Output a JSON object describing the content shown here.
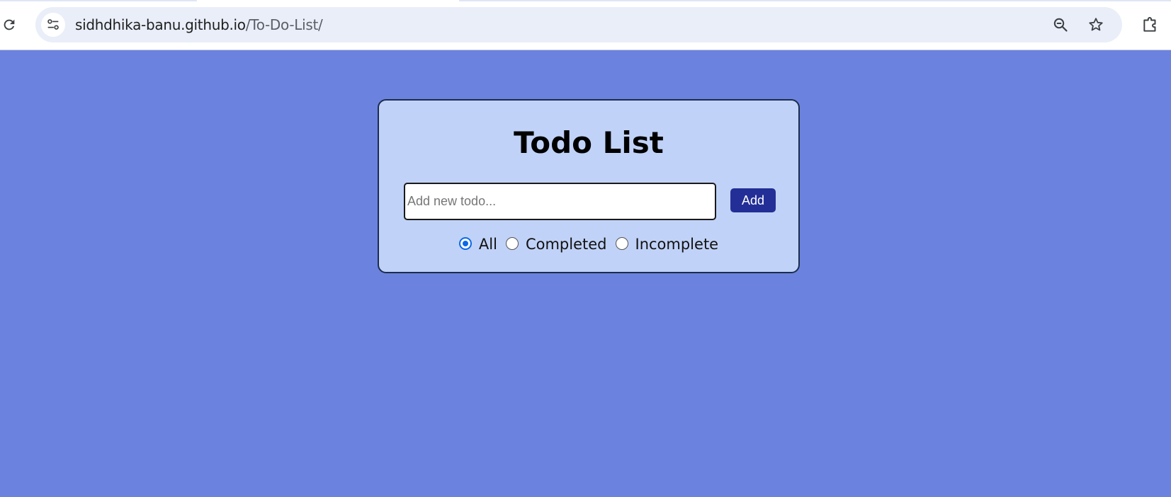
{
  "browser": {
    "url_host": "sidhdhika-banu.github.io",
    "url_path": "/To-Do-List/",
    "icons": {
      "reload": "reload-icon",
      "site_info": "tune-icon",
      "zoom": "zoom-out-icon",
      "bookmark": "star-icon",
      "extensions": "puzzle-icon"
    }
  },
  "app": {
    "title": "Todo List",
    "input": {
      "placeholder": "Add new todo...",
      "value": ""
    },
    "add_label": "Add",
    "filters": [
      {
        "label": "All",
        "checked": true
      },
      {
        "label": "Completed",
        "checked": false
      },
      {
        "label": "Incomplete",
        "checked": false
      }
    ]
  },
  "colors": {
    "page_background": "#6b82df",
    "card_background": "#c1d2f8",
    "button": "#232f96",
    "radio_accent": "#0b6ae8"
  }
}
